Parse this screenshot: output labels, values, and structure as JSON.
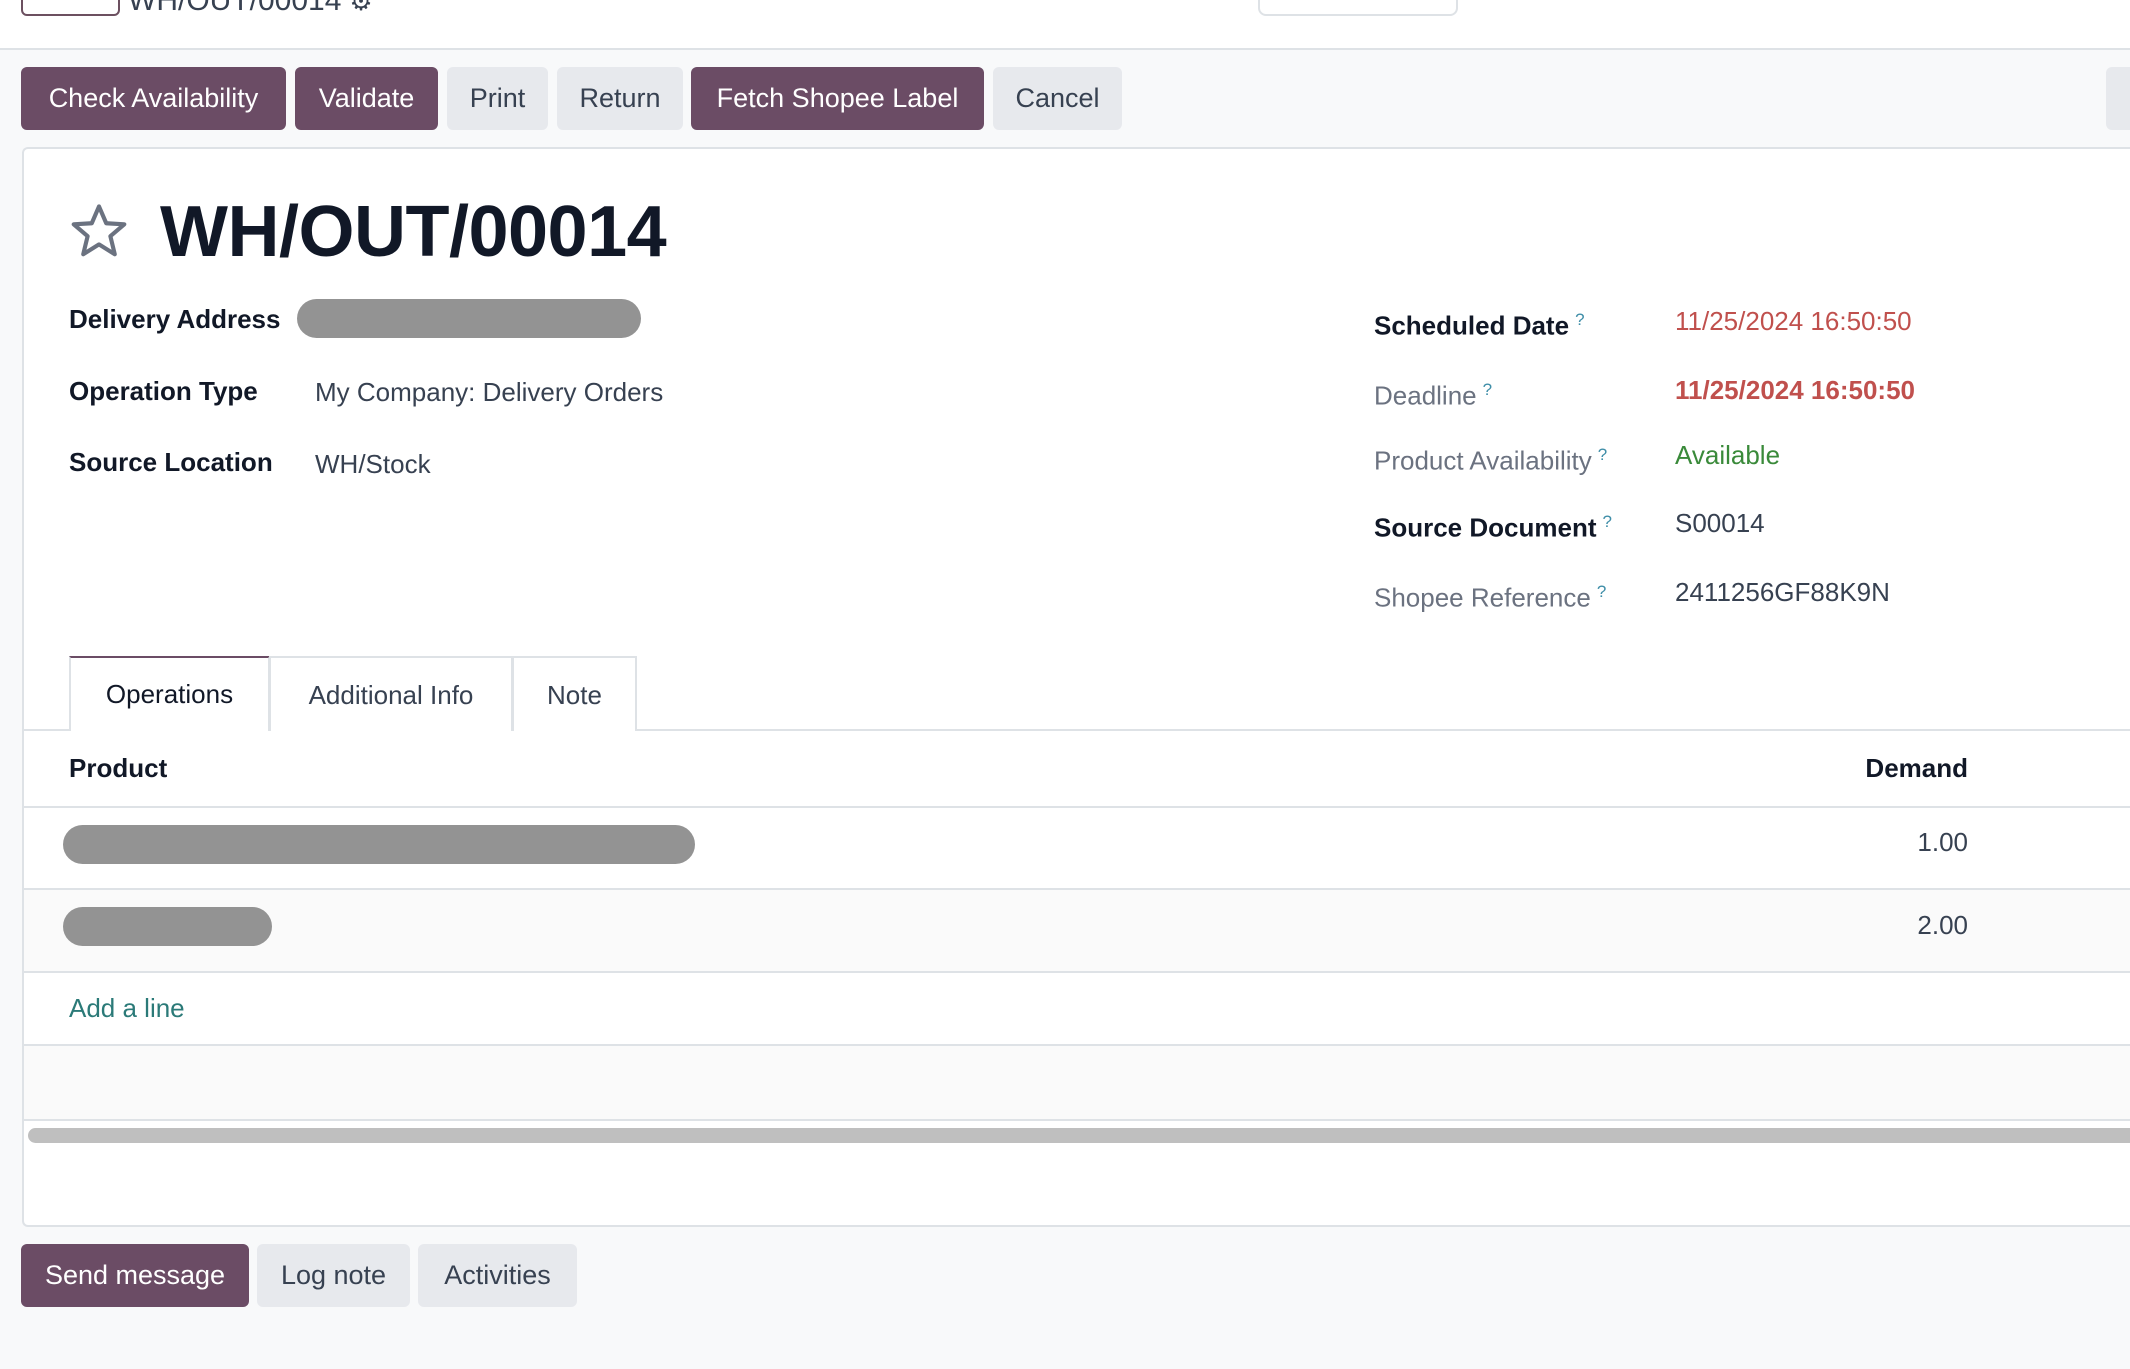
{
  "control_panel": {
    "breadcrumb": "WH/OUT/00014",
    "gear_icon": "gear-icon"
  },
  "actions": {
    "check_availability": "Check Availability",
    "validate": "Validate",
    "print": "Print",
    "return": "Return",
    "fetch_shopee_label": "Fetch Shopee Label",
    "cancel": "Cancel"
  },
  "record": {
    "title": "WH/OUT/00014",
    "favorite_icon": "star-outline-icon",
    "left_fields": {
      "delivery_address": {
        "label": "Delivery Address",
        "value": "[redacted]"
      },
      "operation_type": {
        "label": "Operation Type",
        "value": "My Company: Delivery Orders"
      },
      "source_location": {
        "label": "Source Location",
        "value": "WH/Stock"
      }
    },
    "right_fields": {
      "scheduled_date": {
        "label": "Scheduled Date",
        "help": "?",
        "value": "11/25/2024 16:50:50"
      },
      "deadline": {
        "label": "Deadline",
        "help": "?",
        "value": "11/25/2024 16:50:50"
      },
      "product_availability": {
        "label": "Product Availability",
        "help": "?",
        "value": "Available"
      },
      "source_document": {
        "label": "Source Document",
        "help": "?",
        "value": "S00014"
      },
      "shopee_reference": {
        "label": "Shopee Reference",
        "help": "?",
        "value": "2411256GF88K9N"
      }
    }
  },
  "tabs": [
    {
      "label": "Operations",
      "active": true
    },
    {
      "label": "Additional Info",
      "active": false
    },
    {
      "label": "Note",
      "active": false
    }
  ],
  "operations_table": {
    "columns": [
      "Product",
      "Demand"
    ],
    "rows": [
      {
        "product": "[redacted]",
        "demand": "1.00"
      },
      {
        "product": "[redacted]",
        "demand": "2.00"
      }
    ],
    "add_line": "Add a line"
  },
  "chatter": {
    "send_message": "Send message",
    "log_note": "Log note",
    "activities": "Activities"
  },
  "colors": {
    "brand": "#6b4c65",
    "overdue_date": "#c0504d",
    "available": "#3a8a3a",
    "link": "#2b7a78"
  }
}
